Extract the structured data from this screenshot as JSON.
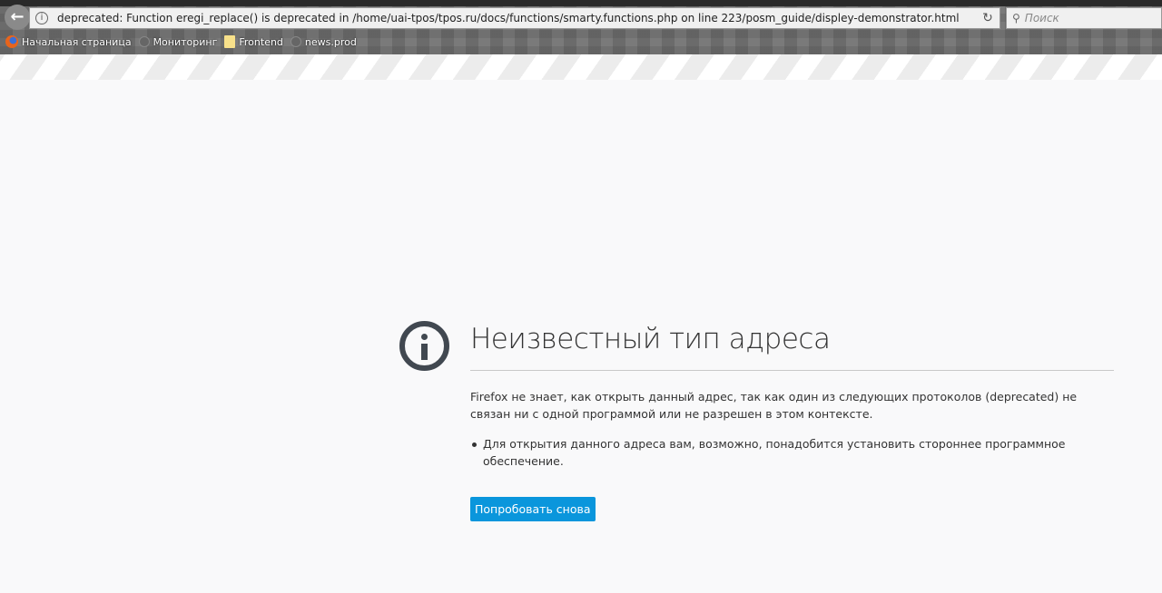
{
  "browser": {
    "url": "deprecated: Function eregi_replace() is deprecated in /home/uai-tpos/tpos.ru/docs/functions/smarty.functions.php on line 223/posm_guide/displey-demonstrator.html",
    "search_placeholder": "Поиск",
    "bookmarks": [
      {
        "label": "Начальная страница",
        "icon": "firefox-icon"
      },
      {
        "label": "Мониторинг",
        "icon": "globe-icon"
      },
      {
        "label": "Frontend",
        "icon": "folder-icon"
      },
      {
        "label": "news.prod",
        "icon": "globe-icon"
      }
    ]
  },
  "error": {
    "title": "Неизвестный тип адреса",
    "description": "Firefox не знает, как открыть данный адрес, так как один из следующих протоколов (deprecated) не связан ни с одной программой или не разрешен в этом контексте.",
    "items": [
      "Для открытия данного адреса вам, возможно, понадобится установить стороннее программное обеспечение."
    ],
    "retry_label": "Попробовать снова"
  },
  "colors": {
    "accent": "#0a96dc",
    "icon": "#414850"
  }
}
